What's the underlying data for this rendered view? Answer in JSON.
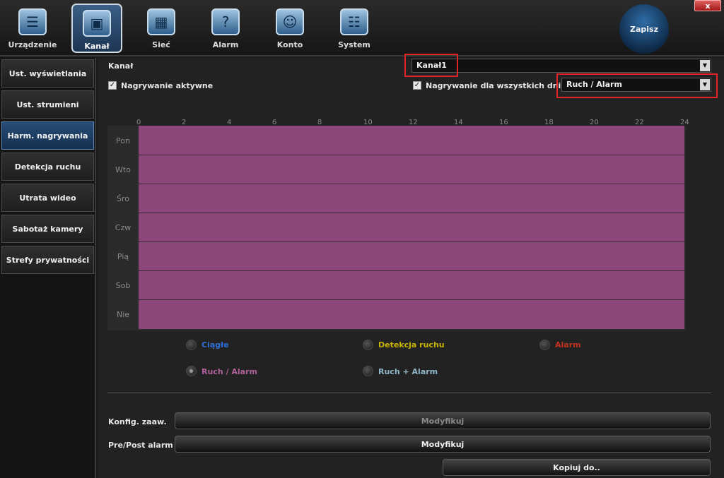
{
  "top_tabs": [
    {
      "label": "Urządzenie",
      "icon": "device-icon",
      "active": false
    },
    {
      "label": "Kanał",
      "icon": "channel-icon",
      "active": true
    },
    {
      "label": "Sieć",
      "icon": "network-icon",
      "active": false
    },
    {
      "label": "Alarm",
      "icon": "alarm-icon",
      "active": false
    },
    {
      "label": "Konto",
      "icon": "account-icon",
      "active": false
    },
    {
      "label": "System",
      "icon": "system-icon",
      "active": false
    }
  ],
  "save_label": "Zapisz",
  "close_label": "x",
  "sidebar": {
    "items": [
      {
        "label": "Ust. wyświetlania",
        "active": false
      },
      {
        "label": "Ust. strumieni",
        "active": false
      },
      {
        "label": "Harm. nagrywania",
        "active": true
      },
      {
        "label": "Detekcja ruchu",
        "active": false
      },
      {
        "label": "Utrata wideo",
        "active": false
      },
      {
        "label": "Sabotaż kamery",
        "active": false
      },
      {
        "label": "Strefy prywatności",
        "active": false
      }
    ]
  },
  "form": {
    "channel_label": "Kanał",
    "channel_value": "Kanał1",
    "recording_active_label": "Nagrywanie aktywne",
    "recording_active_checked": true,
    "all_days_label": "Nagrywanie dla wszystkich dni",
    "all_days_checked": true,
    "mode_value": "Ruch / Alarm"
  },
  "schedule": {
    "hours": [
      "0",
      "2",
      "4",
      "6",
      "8",
      "10",
      "12",
      "14",
      "16",
      "18",
      "20",
      "22",
      "24"
    ],
    "days": [
      "Pon",
      "Wto",
      "Śro",
      "Czw",
      "Pią",
      "Sob",
      "Nie"
    ],
    "fill_color": "#8c477a"
  },
  "legend": [
    {
      "label": "Ciągłe",
      "color": "#2f6fd6",
      "selected": false
    },
    {
      "label": "Detekcja ruchu",
      "color": "#c8b400",
      "selected": false
    },
    {
      "label": "Alarm",
      "color": "#c0321e",
      "selected": false
    },
    {
      "label": "Ruch / Alarm",
      "color": "#b0609a",
      "selected": true
    },
    {
      "label": "Ruch + Alarm",
      "color": "#8fb6c8",
      "selected": false
    }
  ],
  "advanced": {
    "config_label": "Konfig. zaaw.",
    "config_button": "Modyfikuj",
    "prepost_label": "Pre/Post alarm",
    "prepost_button": "Modyfikuj",
    "copy_button": "Kopiuj do.."
  }
}
